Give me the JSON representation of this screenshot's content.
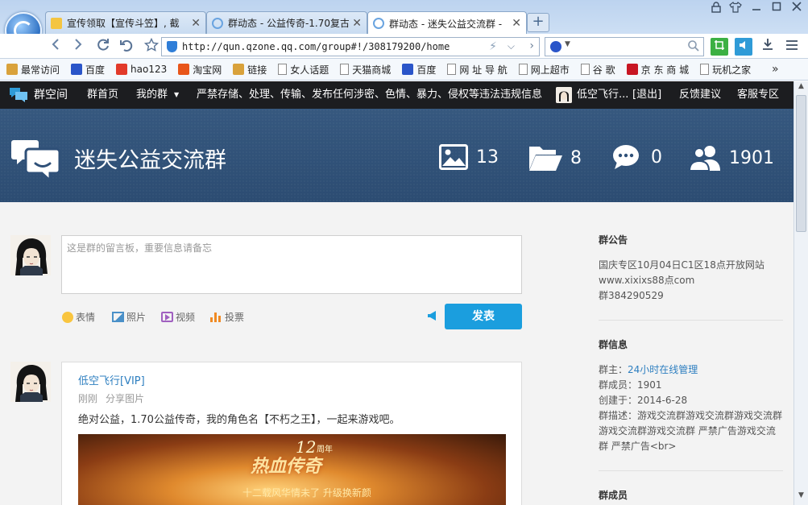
{
  "browser": {
    "tabs": [
      {
        "title": "宣传领取【宣传斗笠】, 截",
        "close": "✕"
      },
      {
        "title": "群动态 - 公益传奇-1.70复古",
        "close": "✕"
      },
      {
        "title": "群动态 - 迷失公益交流群 -",
        "close": "✕"
      }
    ],
    "new_tab": "+",
    "url": "http://qun.qzone.qq.com/group#!/308179200/home",
    "bookmarks": [
      "最常访问",
      "百度",
      "hao123",
      "淘宝网",
      "链接",
      "女人话题",
      "天猫商城",
      "百度",
      "网 址 导 航",
      "网上超市",
      "谷 歌",
      "京 东 商 城",
      "玩机之家"
    ],
    "bookmarks_more": "»"
  },
  "site_nav": {
    "brand": "群空间",
    "home": "群首页",
    "my_group": "我的群",
    "notice": "严禁存储、处理、传输、发布任何涉密、色情、暴力、侵权等违法违规信息",
    "user": "低空飞行...",
    "logout": "[退出]",
    "feedback": "反馈建议",
    "service": "客服专区"
  },
  "banner": {
    "group_name": "迷失公益交流群",
    "stats": {
      "photos": "13",
      "files": "8",
      "comments": "0",
      "members": "1901"
    }
  },
  "composer": {
    "placeholder": "这是群的留言板，重要信息请备忘",
    "tools": [
      "表情",
      "照片",
      "视频",
      "投票"
    ],
    "submit": "发表"
  },
  "post": {
    "author": "低空飞行[VIP]",
    "time": "刚刚",
    "action": "分享图片",
    "text": "绝对公益，1.70公益传奇，我的角色名【不朽之王】，一起来游戏吧。",
    "image_caption": "热血传奇",
    "image_badge": "12",
    "image_badge_unit": "周年",
    "image_sub": "十二载风华情未了 升级换新颜"
  },
  "sidebar": {
    "announcement_title": "群公告",
    "announcement_lines": [
      "国庆专区10月04日C1区18点开放网站",
      "www.xixixs88点com",
      "群384290529"
    ],
    "info_title": "群信息",
    "owner_label": "群主：",
    "owner": "24小时在线管理",
    "members_line": "群成员：1901",
    "created_line": "创建于：2014-6-28",
    "desc_lines": [
      "群描述：游戏交流群游戏交流群游戏交流群",
      "游戏交流群游戏交流群 严禁广告游戏交流",
      "群 严禁广告<br>"
    ],
    "members_title": "群成员"
  },
  "colors": {
    "accent": "#1b9ede",
    "nav_bg": "#1c1d20",
    "banner_bg": "#2f5078",
    "link": "#2e7fc0"
  }
}
